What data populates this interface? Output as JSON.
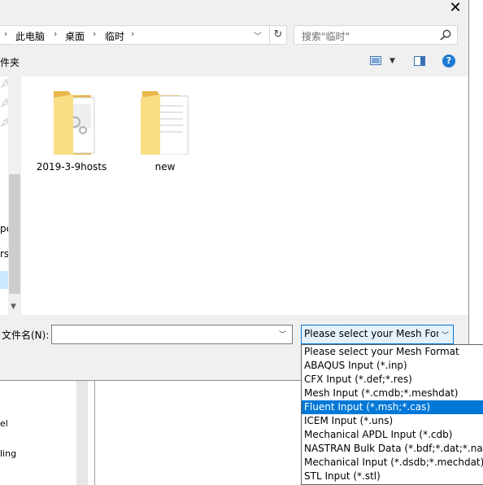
{
  "window": {
    "close_glyph": "✕"
  },
  "address_bar": {
    "breadcrumbs": [
      "此电脑",
      "桌面",
      "临时"
    ],
    "separator": "›"
  },
  "search": {
    "placeholder": "搜索\"临时\""
  },
  "toolbar": {
    "left_label_fragment": "件夹"
  },
  "nav_pane": {
    "fragments": [
      "pe",
      "rs"
    ]
  },
  "files": [
    {
      "name": "2019-3-9hosts",
      "type": "folder"
    },
    {
      "name": "new",
      "type": "folder"
    }
  ],
  "filename_field": {
    "label": "文件名(N):",
    "value": ""
  },
  "file_type_filter": {
    "selected": "Please select your Mesh For",
    "options": [
      "Please select your Mesh Format",
      "ABAQUS Input (*.inp)",
      "CFX Input (*.def;*.res)",
      "Mesh Input (*.cmdb;*.meshdat)",
      "Fluent Input (*.msh;*.cas)",
      "ICEM Input (*.uns)",
      "Mechanical APDL Input (*.cdb)",
      "NASTRAN Bulk Data (*.bdf;*.dat;*.nas)",
      "Mechanical Input (*.dsdb;*.mechdat)",
      "STL Input (*.stl)"
    ],
    "highlighted_index": 4
  },
  "background_app": {
    "fragments": [
      "el",
      "ling"
    ]
  },
  "colors": {
    "accent": "#0078d7",
    "folder": "#f7d774",
    "help": "#1e7ad4"
  }
}
